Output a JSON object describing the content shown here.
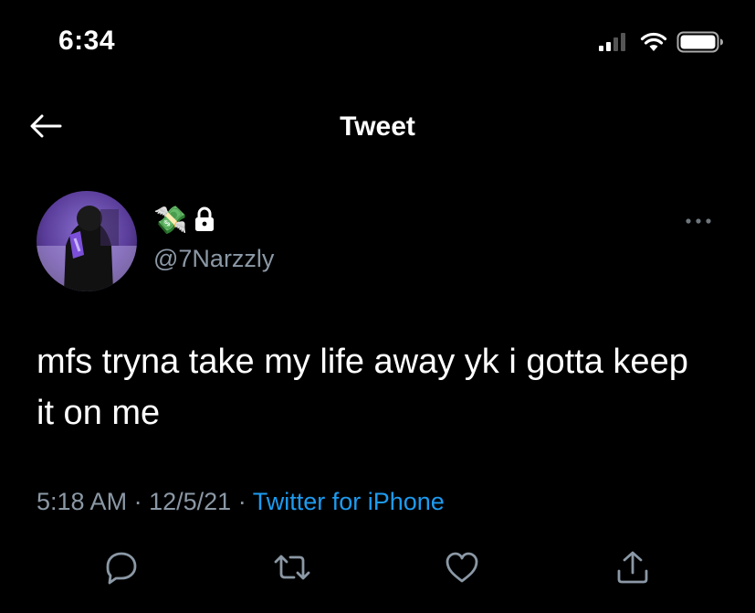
{
  "status_bar": {
    "time": "6:34"
  },
  "header": {
    "title": "Tweet"
  },
  "author": {
    "emoji": "💸",
    "handle": "@7Narzzly"
  },
  "tweet": {
    "text": "mfs tryna take my life away yk i gotta keep it on me",
    "time": "5:18 AM",
    "separator": "·",
    "date": "12/5/21",
    "source": "Twitter for iPhone"
  },
  "colors": {
    "background": "#000000",
    "text": "#ffffff",
    "secondary": "#8b98a5",
    "link": "#1d9bf0"
  },
  "icons": [
    "back-arrow-icon",
    "cellular-signal-icon",
    "wifi-icon",
    "battery-icon",
    "lock-icon",
    "more-icon",
    "reply-icon",
    "retweet-icon",
    "like-icon",
    "share-icon"
  ]
}
